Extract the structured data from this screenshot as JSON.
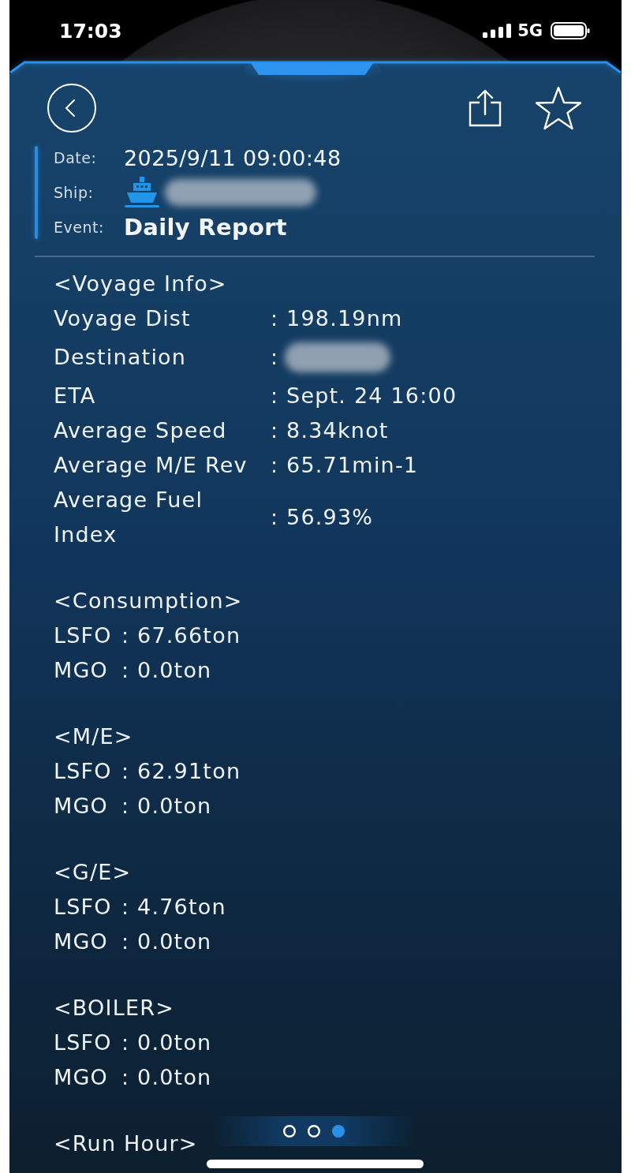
{
  "status_bar": {
    "time": "17:03",
    "network": "5G"
  },
  "header": {
    "favorite": false,
    "fields": [
      {
        "label": "Date:",
        "value": "2025/9/11 09:00:48",
        "kind": "text"
      },
      {
        "label": "Ship:",
        "kind": "ship"
      },
      {
        "label": "Event:",
        "value": "Daily Report",
        "kind": "title"
      }
    ]
  },
  "sections": [
    {
      "title": "<Voyage Info>",
      "kind": "table",
      "rows": [
        {
          "label": "Voyage Dist",
          "value": ": 198.19nm",
          "redacted": false
        },
        {
          "label": "Destination",
          "value": ":",
          "redacted": true
        },
        {
          "label": "ETA",
          "value": ": Sept. 24 16:00",
          "redacted": false
        },
        {
          "label": "Average Speed",
          "value": ": 8.34knot",
          "redacted": false
        },
        {
          "label": "Average M/E Rev",
          "value": ": 65.71min-1",
          "redacted": false
        },
        {
          "label": "Average Fuel Index",
          "value": ": 56.93%",
          "redacted": false
        }
      ]
    },
    {
      "title": "<Consumption>",
      "kind": "list",
      "rows": [
        {
          "label": "LSFO",
          "value": ": 67.66ton"
        },
        {
          "label": "MGO",
          "value": ": 0.0ton"
        }
      ]
    },
    {
      "title": "<M/E>",
      "kind": "list",
      "rows": [
        {
          "label": "LSFO",
          "value": ": 62.91ton"
        },
        {
          "label": "MGO",
          "value": ": 0.0ton"
        }
      ]
    },
    {
      "title": "<G/E>",
      "kind": "list",
      "rows": [
        {
          "label": "LSFO",
          "value": ": 4.76ton"
        },
        {
          "label": "MGO",
          "value": ": 0.0ton"
        }
      ]
    },
    {
      "title": "<BOILER>",
      "kind": "list",
      "rows": [
        {
          "label": "LSFO",
          "value": ": 0.0ton"
        },
        {
          "label": "MGO",
          "value": ": 0.0ton"
        }
      ]
    },
    {
      "title": "<Run Hour>",
      "kind": "list"
    }
  ],
  "pager": [
    {
      "selected": false
    },
    {
      "selected": false
    },
    {
      "selected": true
    }
  ]
}
